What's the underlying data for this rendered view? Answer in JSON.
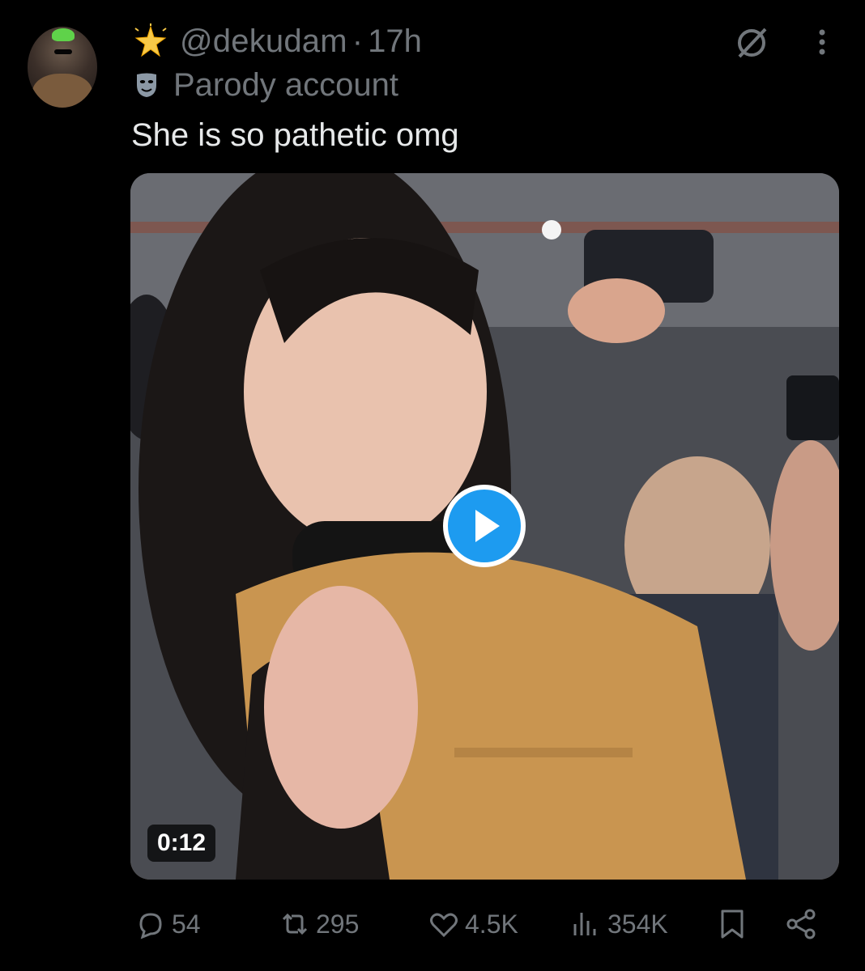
{
  "author": {
    "handle": "@dekudam",
    "separator": "·",
    "time": "17h",
    "label": "Parody account"
  },
  "tweet": {
    "text": "She is so pathetic omg"
  },
  "media": {
    "type": "video",
    "duration": "0:12"
  },
  "actions": {
    "replies": "54",
    "reposts": "295",
    "likes": "4.5K",
    "views": "354K"
  },
  "icons": [
    "sparkle-icon",
    "mask-icon",
    "grok-icon",
    "more-icon",
    "play-icon",
    "reply-icon",
    "repost-icon",
    "like-icon",
    "views-icon",
    "bookmark-icon",
    "share-icon"
  ],
  "colors": {
    "background": "#000000",
    "text": "#e7e9ea",
    "muted": "#71767b",
    "accent": "#1d9bf0"
  }
}
